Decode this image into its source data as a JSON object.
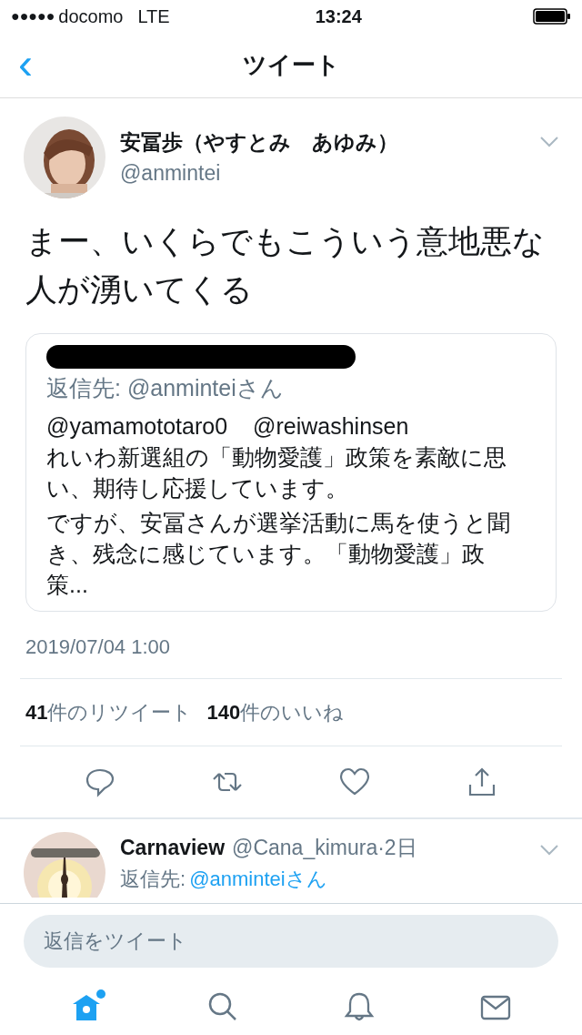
{
  "status_bar": {
    "signal_dots": "●●●●●",
    "carrier": "docomo",
    "network": "LTE",
    "time": "13:24"
  },
  "nav": {
    "back": "‹",
    "title": "ツイート"
  },
  "tweet": {
    "author_name": "安冨歩（やすとみ　あゆみ）",
    "handle": "@anmintei",
    "text": "まー、いくらでもこういう意地悪な人が湧いてくる",
    "quote": {
      "reply_to_label": "返信先:",
      "reply_to": "@anminteiさん",
      "mentions": [
        "@yamamototaro0",
        "@reiwashinsen"
      ],
      "paragraphs": [
        "れいわ新選組の「動物愛護」政策を素敵に思い、期待し応援しています。",
        "ですが、安冨さんが選挙活動に馬を使うと聞き、残念に感じています。「動物愛護」政策..."
      ]
    },
    "timestamp": "2019/07/04 1:00",
    "stats": [
      {
        "count": "41",
        "label": "件のリツイート"
      },
      {
        "count": "140",
        "label": "件のいいね"
      }
    ],
    "actions": [
      {
        "kind": "reply"
      },
      {
        "kind": "retweet"
      },
      {
        "kind": "like"
      },
      {
        "kind": "share"
      }
    ]
  },
  "replies": [
    {
      "name": "Carnaview",
      "handle": "@Cana_kimura",
      "time": "·2日",
      "reply_to_label": "返信先:",
      "reply_to": "@anminteiさん"
    }
  ],
  "reply_box": {
    "placeholder": "返信をツイート"
  },
  "tab_bar": [
    {
      "kind": "home",
      "selected": true,
      "badge": true
    },
    {
      "kind": "search",
      "selected": false,
      "badge": false
    },
    {
      "kind": "notifications",
      "selected": false,
      "badge": false
    },
    {
      "kind": "messages",
      "selected": false,
      "badge": false
    }
  ]
}
